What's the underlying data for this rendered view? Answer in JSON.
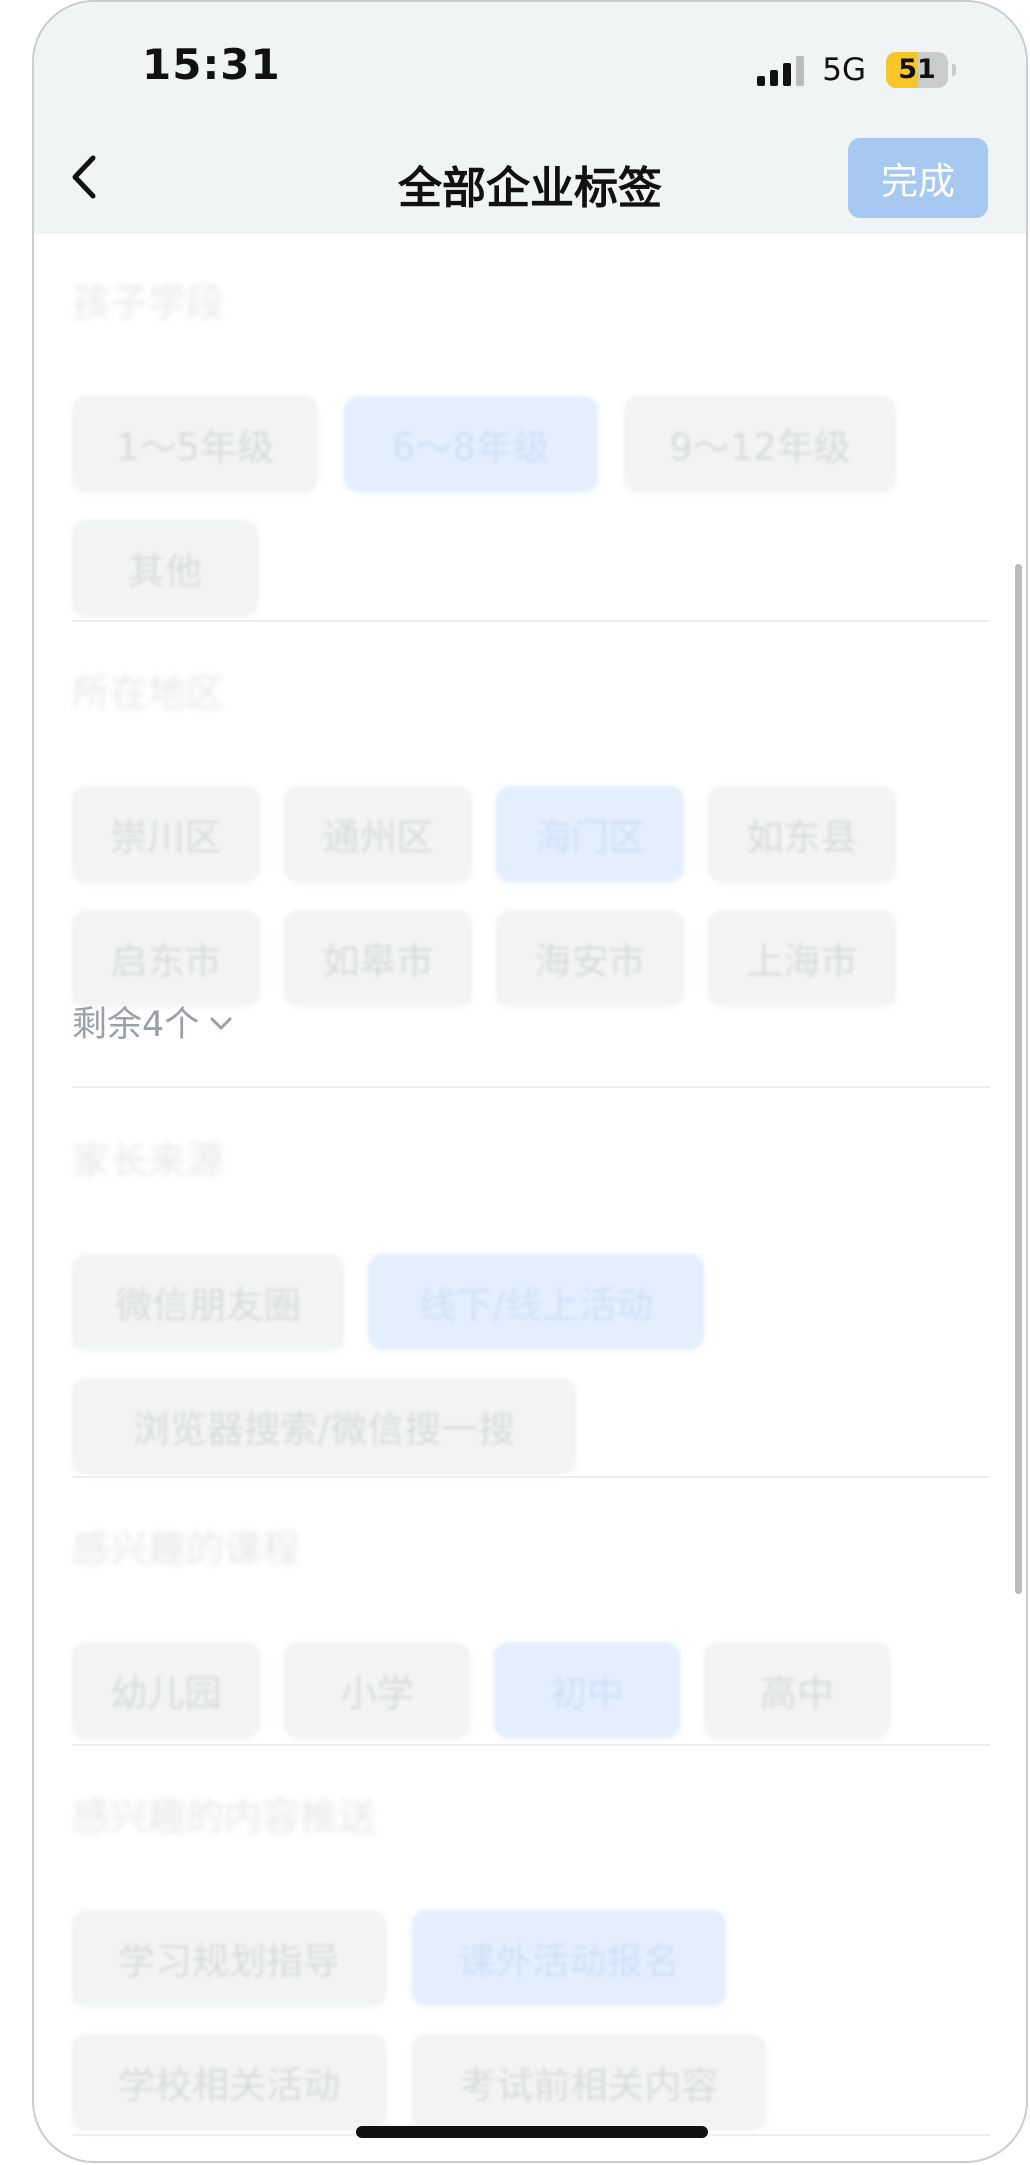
{
  "status_bar": {
    "time": "15:31",
    "network": "5G",
    "battery_level": "51",
    "battery_percent": 51
  },
  "header": {
    "title": "全部企业标签",
    "done_label": "完成"
  },
  "sections": [
    {
      "title": "孩子学段",
      "tags": [
        {
          "label": "1～5年级",
          "selected": false
        },
        {
          "label": "6～8年级",
          "selected": true
        },
        {
          "label": "9～12年级",
          "selected": false
        },
        {
          "label": "其他",
          "selected": false
        }
      ]
    },
    {
      "title": "所在地区",
      "tags": [
        {
          "label": "崇川区",
          "selected": false
        },
        {
          "label": "通州区",
          "selected": false
        },
        {
          "label": "海门区",
          "selected": true
        },
        {
          "label": "如东县",
          "selected": false
        },
        {
          "label": "启东市",
          "selected": false
        },
        {
          "label": "如皋市",
          "selected": false
        },
        {
          "label": "海安市",
          "selected": false
        },
        {
          "label": "上海市",
          "selected": false
        }
      ],
      "more_label": "剩余4个"
    },
    {
      "title": "家长来源",
      "tags": [
        {
          "label": "微信朋友圈",
          "selected": false
        },
        {
          "label": "线下/线上活动",
          "selected": true
        },
        {
          "label": "浏览器搜索/微信搜一搜",
          "selected": false
        }
      ]
    },
    {
      "title": "感兴趣的课程",
      "tags": [
        {
          "label": "幼儿园",
          "selected": false
        },
        {
          "label": "小学",
          "selected": false
        },
        {
          "label": "初中",
          "selected": true
        },
        {
          "label": "高中",
          "selected": false
        }
      ]
    },
    {
      "title": "感兴趣的内容推送",
      "tags": [
        {
          "label": "学习规划指导",
          "selected": false
        },
        {
          "label": "课外活动报名",
          "selected": true
        },
        {
          "label": "学校相关活动",
          "selected": false
        },
        {
          "label": "考试前相关内容",
          "selected": false
        }
      ]
    }
  ]
}
